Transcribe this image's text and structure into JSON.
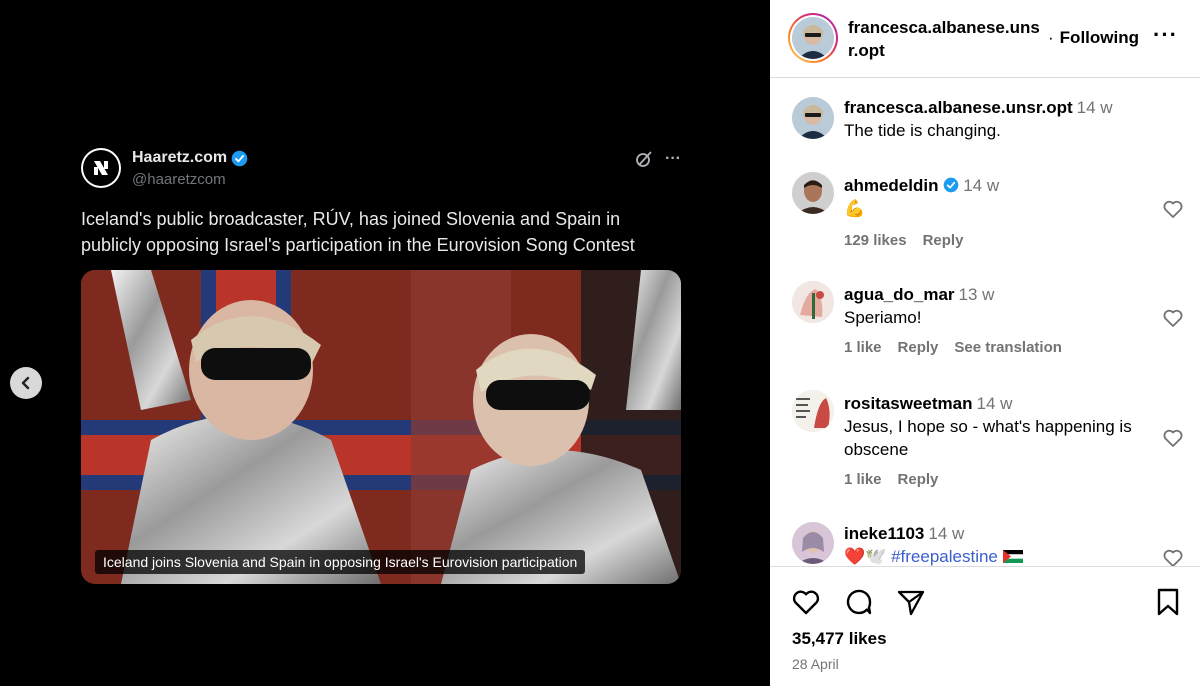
{
  "tweet": {
    "name": "Haaretz.com",
    "handle": "@haaretzcom",
    "text": "Iceland's public broadcaster, RÚV, has joined Slovenia and Spain in publicly opposing Israel's participation in the Eurovision Song Contest",
    "caption": "Iceland joins Slovenia and Spain in opposing Israel's Eurovision participation",
    "more": "···"
  },
  "post": {
    "username": "francesca.albanese.unsr.opt",
    "dot": "·",
    "following": "Following",
    "more": "···"
  },
  "caption_comment": {
    "user": "francesca.albanese.unsr.opt",
    "time": "14 w",
    "text": "The tide is changing."
  },
  "comments": [
    {
      "user": "ahmedeldin",
      "time": "14 w",
      "text": "💪",
      "likes": "129 likes",
      "reply": "Reply",
      "translation": ""
    },
    {
      "user": "agua_do_mar",
      "time": "13 w",
      "text": "Speriamo!",
      "likes": "1 like",
      "reply": "Reply",
      "translation": "See translation"
    },
    {
      "user": "rositasweetman",
      "time": "14 w",
      "text": "Jesus, I hope so - what's happening is obscene",
      "likes": "1 like",
      "reply": "Reply",
      "translation": ""
    },
    {
      "user": "ineke1103",
      "time": "14 w",
      "text": "❤️🕊️",
      "hashtag": "#freepalestine",
      "likes": "",
      "reply": "",
      "translation": ""
    }
  ],
  "footer": {
    "likes": "35,477 likes",
    "date": "28 April"
  },
  "colors": {
    "accent_blue": "#3a5fcc",
    "verified_blue": "#1d9bf0",
    "secondary_text": "#737373"
  },
  "icons": [
    "chevron-left-icon",
    "verified-icon",
    "grok-icon",
    "heart-icon",
    "comment-icon",
    "share-icon",
    "bookmark-icon"
  ]
}
